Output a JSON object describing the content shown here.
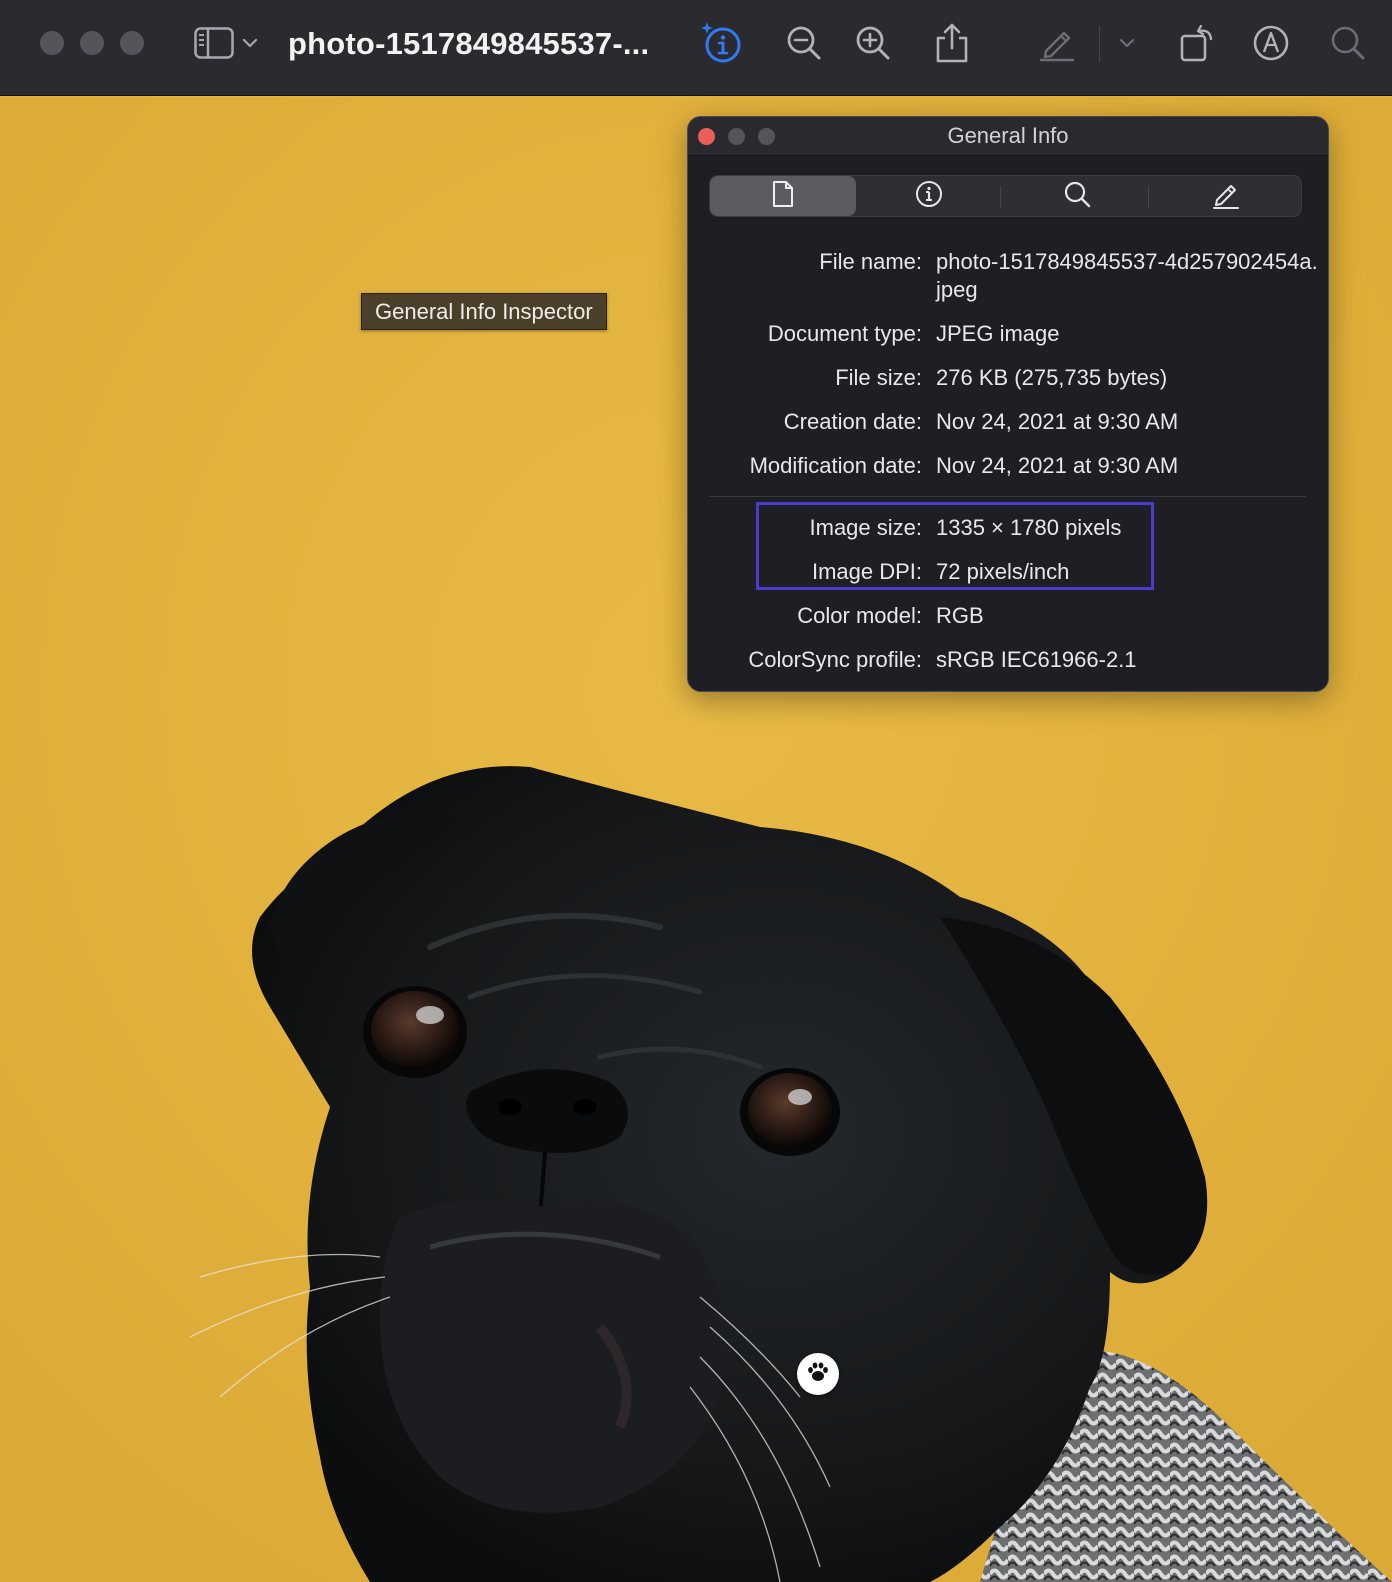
{
  "toolbar": {
    "document_title": "photo-1517849845537-...",
    "icons": [
      "sidebar-icon",
      "chevron-down-icon",
      "info-inspector-icon",
      "zoom-out-icon",
      "zoom-in-icon",
      "share-icon",
      "markup-pen-icon",
      "chevron-down-icon",
      "rotate-icon",
      "markup-toolbar-icon",
      "search-icon"
    ],
    "accent_color": "#2f7bf5"
  },
  "tooltip": {
    "text": "General Info Inspector"
  },
  "inspector": {
    "title": "General Info",
    "tabs": [
      "document-icon",
      "info-icon",
      "search-icon",
      "pencil-icon"
    ],
    "rows": [
      {
        "label": "File name:",
        "value": "photo-1517849845537-4d257902454a.jpeg"
      },
      {
        "label": "Document type:",
        "value": "JPEG image"
      },
      {
        "label": "File size:",
        "value": "276 KB (275,735 bytes)"
      },
      {
        "label": "Creation date:",
        "value": "Nov 24, 2021 at 9:30 AM"
      },
      {
        "label": "Modification date:",
        "value": "Nov 24, 2021 at 9:30 AM"
      },
      {
        "label": "Image size:",
        "value": "1335 × 1780 pixels"
      },
      {
        "label": "Image DPI:",
        "value": "72 pixels/inch"
      },
      {
        "label": "Color model:",
        "value": "RGB"
      },
      {
        "label": "ColorSync profile:",
        "value": "sRGB IEC61966-2.1"
      }
    ],
    "highlight_color": "#4b3bd0"
  },
  "photo": {
    "background_color": "#e4b43e",
    "subject": "black pug wearing a knitted sweater"
  },
  "cursor": {
    "icon": "paw-icon"
  }
}
